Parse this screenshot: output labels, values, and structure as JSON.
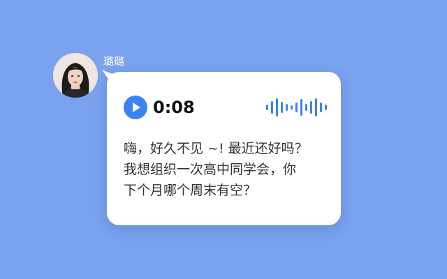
{
  "contact": {
    "name": "璐璐"
  },
  "voice_message": {
    "duration": "0:08",
    "accent_color": "#3b82f6"
  },
  "message": {
    "text": "嗨，好久不见 ~! 最近还好吗？\n我想组织一次高中同学会，你\n下个月哪个周末有空？"
  },
  "colors": {
    "background": "#7aa2ee",
    "bubble": "#ffffff",
    "text": "#333333"
  },
  "icons": {
    "play": "play-icon",
    "waveform": "audio-waveform-icon",
    "avatar": "avatar"
  }
}
